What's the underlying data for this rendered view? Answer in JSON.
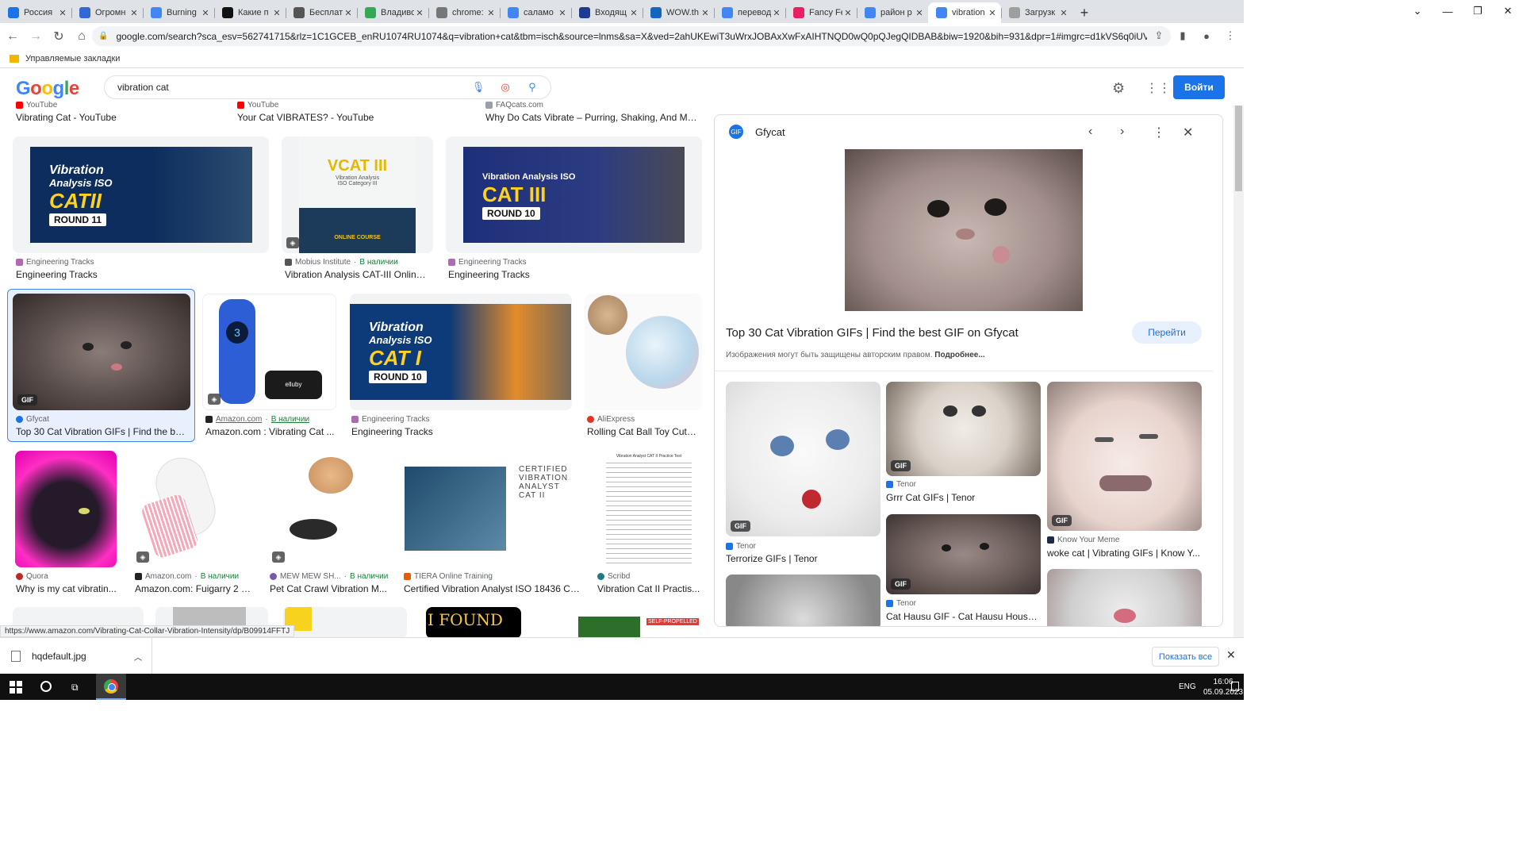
{
  "tabs": [
    {
      "title": "Россия",
      "color": "#1a73e8"
    },
    {
      "title": "Огромн",
      "color": "#3367d6"
    },
    {
      "title": "Burning",
      "color": "#4285f4"
    },
    {
      "title": "Какие п",
      "color": "#111111"
    },
    {
      "title": "Бесплат",
      "color": "#555555"
    },
    {
      "title": "Владиво",
      "color": "#34a853"
    },
    {
      "title": "chrome:",
      "color": "#777777"
    },
    {
      "title": "саламо",
      "color": "#4285f4"
    },
    {
      "title": "Входящ",
      "color": "#1f3a93"
    },
    {
      "title": "WOW.th",
      "color": "#1565c0"
    },
    {
      "title": "перевод",
      "color": "#4285f4"
    },
    {
      "title": "Fancy Fe",
      "color": "#e91e63"
    },
    {
      "title": "район р",
      "color": "#4285f4"
    },
    {
      "title": "vibration",
      "color": "#4285f4"
    },
    {
      "title": "Загрузк",
      "color": "#9e9e9e"
    }
  ],
  "address": {
    "url": "google.com/search?sca_esv=562741715&rlz=1C1GCEB_enRU1074RU1074&q=vibration+cat&tbm=isch&source=lnms&sa=X&ved=2ahUKEwiT3uWrxJOBAxXwFxAIHTNQD0wQ0pQJegQIDBAB&biw=1920&bih=931&dpr=1#imgrc=d1kVS6q0iUVA4M"
  },
  "bookmarks": {
    "label": "Управляемые закладки"
  },
  "google": {
    "logo": "Google",
    "query": "vibration cat",
    "signin": "Войти"
  },
  "top_row": [
    {
      "source": "YouTube",
      "title": "Vibrating Cat - YouTube"
    },
    {
      "source": "YouTube",
      "title": "Your Cat VIBRATES? - YouTube"
    },
    {
      "source": "FAQcats.com",
      "title": "Why Do Cats Vibrate – Purring, Shaking, And Mea..."
    }
  ],
  "row1": [
    {
      "source": "Engineering Tracks",
      "title": "Engineering Tracks",
      "banner": [
        "Vibration",
        "Analysis ISO",
        "CATII",
        "ROUND 11"
      ]
    },
    {
      "source": "Mobius Institute",
      "stock": "В наличии",
      "title": "Vibration Analysis CAT-III Online ...",
      "banner": [
        "VCAT III",
        "Vibration Analysis",
        "ISO Category III",
        "ONLINE COURSE"
      ]
    },
    {
      "source": "Engineering Tracks",
      "title": "Engineering Tracks",
      "banner": [
        "Vibration Analysis ISO",
        "CAT III",
        "ROUND 10"
      ]
    }
  ],
  "row2": [
    {
      "source": "Gfycat",
      "title": "Top 30 Cat Vibration GIFs | Find the bes...",
      "badge": "GIF"
    },
    {
      "source": "Amazon.com",
      "stock": "В наличии",
      "title": "Amazon.com : Vibrating Cat ...",
      "device": "3",
      "brand": "elluby"
    },
    {
      "source": "Engineering Tracks",
      "title": "Engineering Tracks",
      "banner": [
        "Vibration",
        "Analysis ISO",
        "CAT I",
        "ROUND 10"
      ]
    },
    {
      "source": "AliExpress",
      "title": "Rolling Cat Ball Toy Cute ..."
    }
  ],
  "row3": [
    {
      "source": "Quora",
      "title": "Why is my cat vibratin..."
    },
    {
      "source": "Amazon.com",
      "stock": "В наличии",
      "title": "Amazon.com: Fuigarry 2 P..."
    },
    {
      "source": "MEW MEW SH...",
      "stock": "В наличии",
      "title": "Pet Cat Crawl Vibration M..."
    },
    {
      "source": "TIERA Online Training",
      "title": "Certified Vibration Analyst ISO 18436 CA...",
      "cert": [
        "CERTIFIED",
        "VIBRATION",
        "ANALYST",
        "CAT II"
      ]
    },
    {
      "source": "Scribd",
      "title": "Vibration Cat II Practis...",
      "doc_title": "Vibration Analyst CAT II Practice Test"
    }
  ],
  "row4": {
    "found": "I FOUND",
    "self": "SELF-PROPELLED"
  },
  "panel": {
    "source": "Gfycat",
    "title": "Top 30 Cat Vibration GIFs | Find the best GIF on Gfycat",
    "go": "Перейти",
    "copyright": "Изображения могут быть защищены авторским правом.",
    "more": "Подробнее...",
    "related": [
      {
        "source": "Tenor",
        "title": "Terrorize GIFs | Tenor",
        "badge": "GIF"
      },
      {
        "source": "Tenor",
        "title": "Grrr Cat GIFs | Tenor",
        "badge": "GIF"
      },
      {
        "source": "Know Your Meme",
        "title": "woke cat | Vibrating GIFs | Know Y...",
        "badge": "GIF"
      },
      {
        "source": "Tenor",
        "title": "Cat Hausu GIF - Cat Hausu House...",
        "badge": "GIF"
      }
    ]
  },
  "status": {
    "url": "https://www.amazon.com/Vibrating-Cat-Collar-Vibration-Intensity/dp/B09914FFTJ"
  },
  "download": {
    "file": "hqdefault.jpg",
    "show_all": "Показать все"
  },
  "taskbar": {
    "lang": "ENG",
    "time": "16:06",
    "date": "05.09.2023"
  }
}
